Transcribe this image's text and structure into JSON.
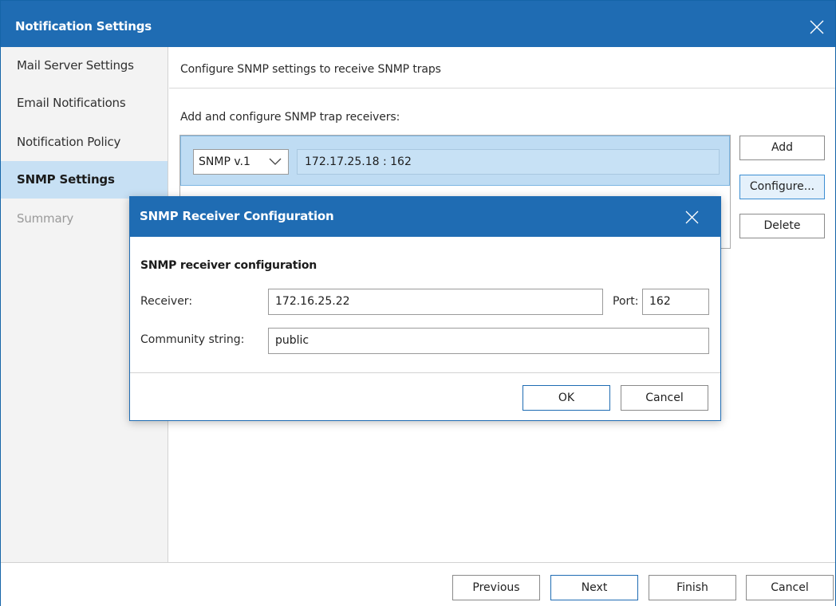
{
  "window": {
    "title": "Notification Settings"
  },
  "sidebar": {
    "items": [
      {
        "label": "Mail Server Settings",
        "state": "normal"
      },
      {
        "label": "Email Notifications",
        "state": "normal"
      },
      {
        "label": "Notification Policy",
        "state": "normal"
      },
      {
        "label": "SNMP Settings",
        "state": "active"
      },
      {
        "label": "Summary",
        "state": "disabled"
      }
    ]
  },
  "main": {
    "header": "Configure SNMP settings to receive SNMP traps",
    "list_label": "Add and configure SNMP trap receivers:",
    "receivers": [
      {
        "version": "SNMP v.1",
        "address": "172.17.25.18 : 162"
      }
    ],
    "buttons": {
      "add": "Add",
      "configure": "Configure...",
      "delete": "Delete"
    }
  },
  "footer": {
    "previous": "Previous",
    "next": "Next",
    "finish": "Finish",
    "cancel": "Cancel"
  },
  "dialog": {
    "title": "SNMP Receiver Configuration",
    "section": "SNMP receiver configuration",
    "receiver_label": "Receiver:",
    "receiver_value": "172.16.25.22",
    "port_label": "Port:",
    "port_value": "162",
    "community_label": "Community string:",
    "community_value": "public",
    "ok": "OK",
    "cancel": "Cancel"
  },
  "colors": {
    "accent": "#1f6cb3",
    "selection": "#c7e0f4",
    "row_selection": "#bfdcf3"
  },
  "icons": {
    "close": "close-icon",
    "dropdown": "chevron-down-icon"
  }
}
